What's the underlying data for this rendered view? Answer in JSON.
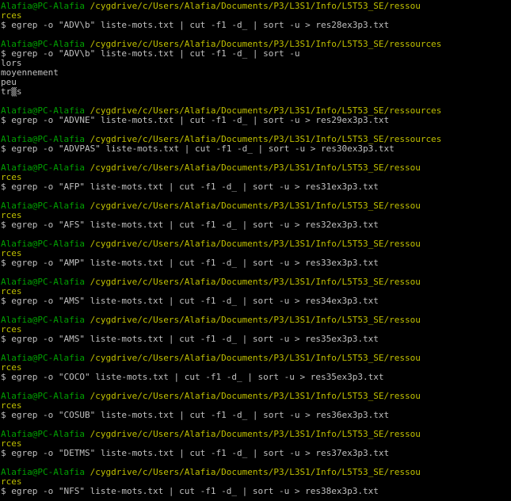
{
  "terminal": {
    "colors": {
      "background": "#000000",
      "user_host": "#00a000",
      "path": "#c0c000",
      "text": "#c0c0c0"
    },
    "lines": [
      {
        "type": "prompt",
        "user": "Alafia@PC-Alafia",
        "path": "/cygdrive/c/Users/Alafia/Documents/P3/L3S1/Info/L5T53_SE/ressou"
      },
      {
        "type": "wrap",
        "text": "rces"
      },
      {
        "type": "cmd",
        "text": "$ egrep -o \"ADV\\b\" liste-mots.txt | cut -f1 -d_ | sort -u > res28ex3p3.txt"
      },
      {
        "type": "blank"
      },
      {
        "type": "prompt",
        "user": "Alafia@PC-Alafia",
        "path": "/cygdrive/c/Users/Alafia/Documents/P3/L3S1/Info/L5T53_SE/ressources"
      },
      {
        "type": "cmd",
        "text": "$ egrep -o \"ADV\\b\" liste-mots.txt | cut -f1 -d_ | sort -u"
      },
      {
        "type": "out",
        "text": "lors"
      },
      {
        "type": "out",
        "text": "moyennement"
      },
      {
        "type": "out",
        "text": "peu"
      },
      {
        "type": "out",
        "text": "tr▒s"
      },
      {
        "type": "blank"
      },
      {
        "type": "prompt",
        "user": "Alafia@PC-Alafia",
        "path": "/cygdrive/c/Users/Alafia/Documents/P3/L3S1/Info/L5T53_SE/ressources"
      },
      {
        "type": "cmd",
        "text": "$ egrep -o \"ADVNE\" liste-mots.txt | cut -f1 -d_ | sort -u > res29ex3p3.txt"
      },
      {
        "type": "blank"
      },
      {
        "type": "prompt",
        "user": "Alafia@PC-Alafia",
        "path": "/cygdrive/c/Users/Alafia/Documents/P3/L3S1/Info/L5T53_SE/ressources"
      },
      {
        "type": "cmd",
        "text": "$ egrep -o \"ADVPAS\" liste-mots.txt | cut -f1 -d_ | sort -u > res30ex3p3.txt"
      },
      {
        "type": "blank"
      },
      {
        "type": "prompt",
        "user": "Alafia@PC-Alafia",
        "path": "/cygdrive/c/Users/Alafia/Documents/P3/L3S1/Info/L5T53_SE/ressou"
      },
      {
        "type": "wrap",
        "text": "rces"
      },
      {
        "type": "cmd",
        "text": "$ egrep -o \"AFP\" liste-mots.txt | cut -f1 -d_ | sort -u > res31ex3p3.txt"
      },
      {
        "type": "blank"
      },
      {
        "type": "prompt",
        "user": "Alafia@PC-Alafia",
        "path": "/cygdrive/c/Users/Alafia/Documents/P3/L3S1/Info/L5T53_SE/ressou"
      },
      {
        "type": "wrap",
        "text": "rces"
      },
      {
        "type": "cmd",
        "text": "$ egrep -o \"AFS\" liste-mots.txt | cut -f1 -d_ | sort -u > res32ex3p3.txt"
      },
      {
        "type": "blank"
      },
      {
        "type": "prompt",
        "user": "Alafia@PC-Alafia",
        "path": "/cygdrive/c/Users/Alafia/Documents/P3/L3S1/Info/L5T53_SE/ressou"
      },
      {
        "type": "wrap",
        "text": "rces"
      },
      {
        "type": "cmd",
        "text": "$ egrep -o \"AMP\" liste-mots.txt | cut -f1 -d_ | sort -u > res33ex3p3.txt"
      },
      {
        "type": "blank"
      },
      {
        "type": "prompt",
        "user": "Alafia@PC-Alafia",
        "path": "/cygdrive/c/Users/Alafia/Documents/P3/L3S1/Info/L5T53_SE/ressou"
      },
      {
        "type": "wrap",
        "text": "rces"
      },
      {
        "type": "cmd",
        "text": "$ egrep -o \"AMS\" liste-mots.txt | cut -f1 -d_ | sort -u > res34ex3p3.txt"
      },
      {
        "type": "blank"
      },
      {
        "type": "prompt",
        "user": "Alafia@PC-Alafia",
        "path": "/cygdrive/c/Users/Alafia/Documents/P3/L3S1/Info/L5T53_SE/ressou"
      },
      {
        "type": "wrap",
        "text": "rces"
      },
      {
        "type": "cmd",
        "text": "$ egrep -o \"AMS\" liste-mots.txt | cut -f1 -d_ | sort -u > res35ex3p3.txt"
      },
      {
        "type": "blank"
      },
      {
        "type": "prompt",
        "user": "Alafia@PC-Alafia",
        "path": "/cygdrive/c/Users/Alafia/Documents/P3/L3S1/Info/L5T53_SE/ressou"
      },
      {
        "type": "wrap",
        "text": "rces"
      },
      {
        "type": "cmd",
        "text": "$ egrep -o \"COCO\" liste-mots.txt | cut -f1 -d_ | sort -u > res35ex3p3.txt"
      },
      {
        "type": "blank"
      },
      {
        "type": "prompt",
        "user": "Alafia@PC-Alafia",
        "path": "/cygdrive/c/Users/Alafia/Documents/P3/L3S1/Info/L5T53_SE/ressou"
      },
      {
        "type": "wrap",
        "text": "rces"
      },
      {
        "type": "cmd",
        "text": "$ egrep -o \"COSUB\" liste-mots.txt | cut -f1 -d_ | sort -u > res36ex3p3.txt"
      },
      {
        "type": "blank"
      },
      {
        "type": "prompt",
        "user": "Alafia@PC-Alafia",
        "path": "/cygdrive/c/Users/Alafia/Documents/P3/L3S1/Info/L5T53_SE/ressou"
      },
      {
        "type": "wrap",
        "text": "rces"
      },
      {
        "type": "cmd",
        "text": "$ egrep -o \"DETMS\" liste-mots.txt | cut -f1 -d_ | sort -u > res37ex3p3.txt"
      },
      {
        "type": "blank"
      },
      {
        "type": "prompt",
        "user": "Alafia@PC-Alafia",
        "path": "/cygdrive/c/Users/Alafia/Documents/P3/L3S1/Info/L5T53_SE/ressou"
      },
      {
        "type": "wrap",
        "text": "rces"
      },
      {
        "type": "cmd",
        "text": "$ egrep -o \"NFS\" liste-mots.txt | cut -f1 -d_ | sort -u > res38ex3p3.txt"
      }
    ]
  }
}
